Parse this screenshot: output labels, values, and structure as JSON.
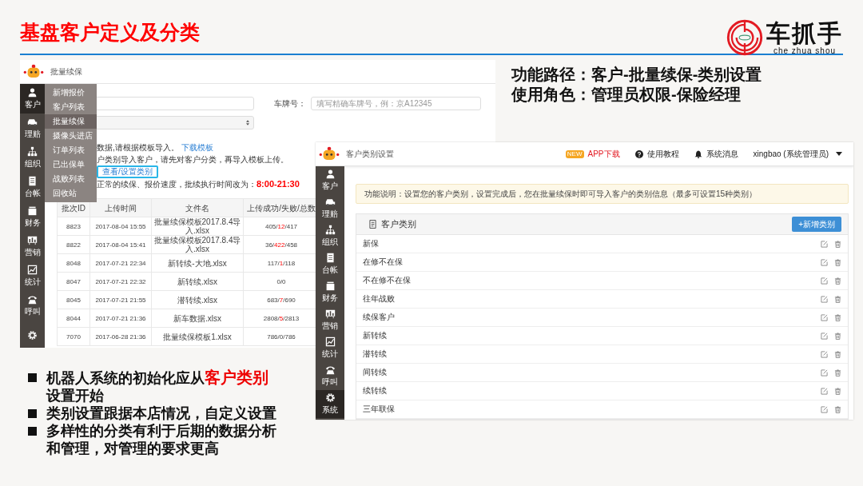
{
  "slide": {
    "title": "基盘客户定义及分类",
    "brand": {
      "name": "车抓手",
      "pinyin": "che zhua shou"
    }
  },
  "info_lines": [
    "功能路径：客户-批量续保-类别设置",
    "使用角色：管理员权限-保险经理"
  ],
  "screenshot_batch": {
    "page_title": "批量续保",
    "sidebar": [
      {
        "label": "客户",
        "selected": true
      },
      {
        "label": "理赔",
        "selected": false
      },
      {
        "label": "组织",
        "selected": false
      },
      {
        "label": "台帐",
        "selected": false
      },
      {
        "label": "财务",
        "selected": false
      },
      {
        "label": "营销",
        "selected": false
      },
      {
        "label": "统计",
        "selected": false
      },
      {
        "label": "呼叫",
        "selected": false
      }
    ],
    "submenu": [
      {
        "label": "新增报价",
        "selected": false
      },
      {
        "label": "客户列表",
        "selected": false
      },
      {
        "label": "批量续保",
        "selected": true
      },
      {
        "label": "摄像头进店",
        "selected": false
      },
      {
        "label": "订单列表",
        "selected": false
      },
      {
        "label": "已出保单",
        "selected": false
      },
      {
        "label": "战败列表",
        "selected": false
      },
      {
        "label": "回收站",
        "selected": false
      }
    ],
    "plate_label": "车牌号：",
    "plate_placeholder": "填写精确车牌号，例：京A12345",
    "notes": [
      {
        "kind": "link",
        "text": "数据,请根据模板导入。",
        "extra": "下载模板"
      },
      {
        "kind": "button",
        "text": "户类别导入客户，请先对客户分类，再导入模板上传。",
        "extra": "查看/设置类别"
      },
      {
        "kind": "highlight",
        "text": "正常的续保、报价速度，批续执行时间改为：",
        "extra": "8:00-21:30"
      }
    ],
    "table": {
      "columns": [
        "批次ID",
        "上传时间",
        "文件名",
        "上传成功/失败/总数"
      ],
      "rows": [
        {
          "id": "8823",
          "time": "2017-08-04 15:55",
          "file": "批量续保模板2017.8.4导入.xlsx",
          "counts": [
            {
              "text": "405/",
              "failed": false
            },
            {
              "text": "12",
              "failed": true
            },
            {
              "text": "/417",
              "failed": false
            }
          ]
        },
        {
          "id": "8822",
          "time": "2017-08-04 15:41",
          "file": "批量续保模板2017.8.4导入.xlsx",
          "counts": [
            {
              "text": "36/",
              "failed": false
            },
            {
              "text": "422",
              "failed": true
            },
            {
              "text": "/458",
              "failed": false
            }
          ]
        },
        {
          "id": "8048",
          "time": "2017-07-21 22:34",
          "file": "新转续-大地.xlsx",
          "counts": [
            {
              "text": "117/",
              "failed": false
            },
            {
              "text": "1",
              "failed": true
            },
            {
              "text": "/118",
              "failed": false
            }
          ]
        },
        {
          "id": "8047",
          "time": "2017-07-21 22:32",
          "file": "新转续.xlsx",
          "counts": [
            {
              "text": "0/0",
              "failed": false
            }
          ]
        },
        {
          "id": "8045",
          "time": "2017-07-21 21:55",
          "file": "潜转续.xlsx",
          "counts": [
            {
              "text": "683/",
              "failed": false
            },
            {
              "text": "7",
              "failed": true
            },
            {
              "text": "/690",
              "failed": false
            }
          ]
        },
        {
          "id": "8044",
          "time": "2017-07-21 21:36",
          "file": "新车数据.xlsx",
          "counts": [
            {
              "text": "2808/",
              "failed": false
            },
            {
              "text": "5",
              "failed": true
            },
            {
              "text": "/2813",
              "failed": false
            }
          ]
        },
        {
          "id": "7070",
          "time": "2017-06-28 21:36",
          "file": "批量续保模板1.xlsx",
          "counts": [
            {
              "text": "786/0/786",
              "failed": false
            }
          ]
        }
      ]
    }
  },
  "screenshot_categories": {
    "page_title": "客户类别设置",
    "app_badge": "NEW",
    "app_link": "APP下载",
    "help": "使用教程",
    "messages": "系统消息",
    "user": "xingbao (系统管理员)",
    "sidebar": [
      {
        "label": "客户",
        "selected": false
      },
      {
        "label": "理赔",
        "selected": false
      },
      {
        "label": "组织",
        "selected": false
      },
      {
        "label": "台帐",
        "selected": false
      },
      {
        "label": "财务",
        "selected": false
      },
      {
        "label": "营销",
        "selected": false
      },
      {
        "label": "统计",
        "selected": false
      },
      {
        "label": "呼叫",
        "selected": false
      },
      {
        "label": "系统",
        "selected": true
      }
    ],
    "notice": "功能说明：设置您的客户类别，设置完成后，您在批量续保时即可导入客户的类别信息（最多可设置15种类别）",
    "panel_title": "客户类别",
    "add_button": "+新增类别",
    "categories": [
      "新保",
      "在修不在保",
      "不在修不在保",
      "往年战败",
      "续保客户",
      "新转续",
      "潜转续",
      "间转续",
      "续转续",
      "三年联保"
    ]
  },
  "bullets": [
    "机器人系统的初始化应从**客户类别**设置开始",
    "类别设置跟据本店情况，自定义设置",
    "多样性的分类有利于后期的数据分析和管理，对管理的要求更高"
  ]
}
